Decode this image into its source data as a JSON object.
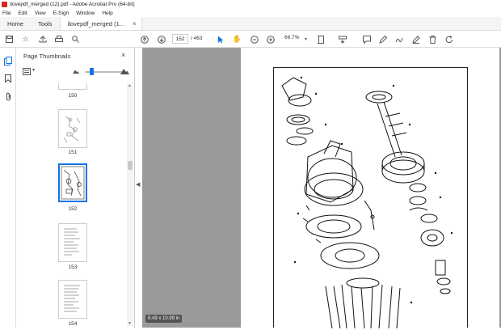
{
  "window": {
    "title": "ilovepdf_merged (12).pdf - Adobe Acrobat Pro (64-bit)"
  },
  "menu": {
    "items": [
      "File",
      "Edit",
      "View",
      "E-Sign",
      "Window",
      "Help"
    ]
  },
  "tabs": {
    "home": "Home",
    "tools": "Tools",
    "document": "ilovepdf_merged (1...",
    "close": "×"
  },
  "toolbar": {
    "current_page": "152",
    "total_pages": "/ 463",
    "zoom": "66.7%"
  },
  "panel": {
    "title": "Page Thumbnails",
    "close": "×",
    "thumbnails": [
      {
        "label": "150"
      },
      {
        "label": "151"
      },
      {
        "label": "152",
        "selected": true
      },
      {
        "label": "153"
      },
      {
        "label": "154"
      }
    ]
  },
  "status": {
    "page_dimensions": "8.49 x 10.99 in"
  },
  "colors": {
    "accent": "#1473e6",
    "app_icon": "#d8271c",
    "viewer_bg": "#9a9a9a"
  }
}
